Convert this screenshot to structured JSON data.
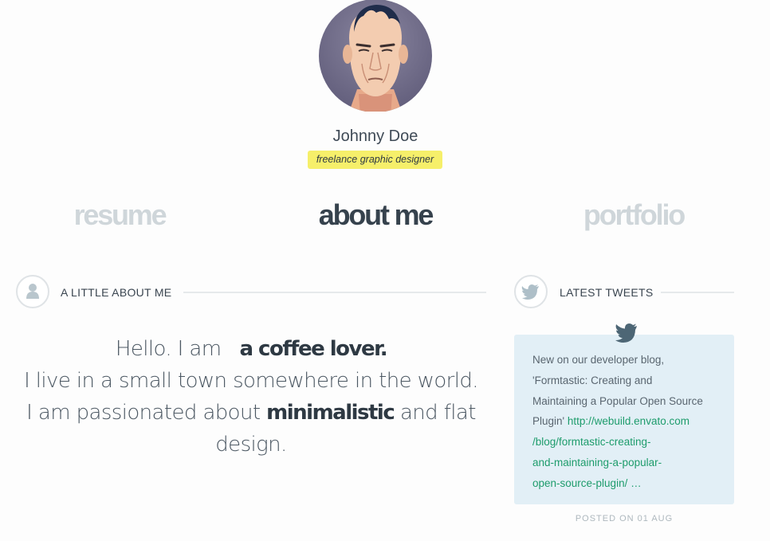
{
  "profile": {
    "name": "Johnny Doe",
    "tagline": "freelance graphic designer",
    "avatar_icon": "face-portrait-icon"
  },
  "nav": {
    "items": [
      {
        "label": "resume",
        "active": false
      },
      {
        "label": "about me",
        "active": true
      },
      {
        "label": "portfolio",
        "active": false
      }
    ]
  },
  "about": {
    "title": "A LITTLE ABOUT ME",
    "icon": "user-icon",
    "intro": "Hello. I am",
    "highlight": "a coffee lover.",
    "line2": "I live in a small town somewhere in the world.",
    "line3_start": "I am passionated about",
    "line3_bold": "minimalistic",
    "line3_end": "and flat",
    "line4": "design."
  },
  "tweets": {
    "title": "LATEST TWEETS",
    "icon": "twitter-bird-icon",
    "text_lines": [
      "New on our developer blog,",
      "'Formtastic: Creating and",
      "Maintaining a Popular Open Source",
      "Plugin'"
    ],
    "link_lines": [
      "http://webuild.envato.com",
      "/blog/formtastic-creating-",
      "and-maintaining-a-popular-",
      "open-source-plugin/ …"
    ],
    "posted": "POSTED ON 01 AUG"
  },
  "colors": {
    "accent_yellow": "#f6ef6a",
    "link_green": "#1e9c6c",
    "tweet_bg": "#e2eff6",
    "nav_inactive": "#cfd6da",
    "nav_active": "#36424d"
  }
}
